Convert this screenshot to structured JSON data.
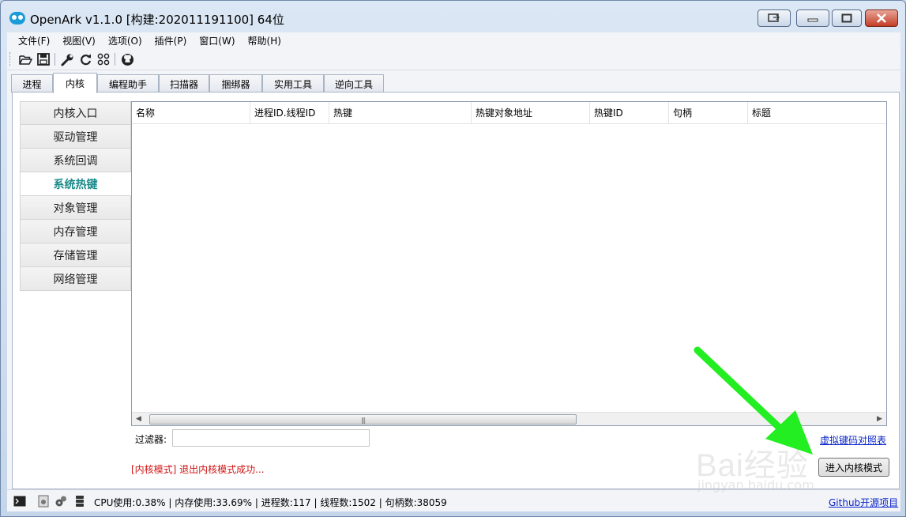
{
  "window": {
    "title": "OpenArk v1.1.0  [构建:202011191100]  64位"
  },
  "menu": [
    "文件(F)",
    "视图(V)",
    "选项(O)",
    "插件(P)",
    "窗口(W)",
    "帮助(H)"
  ],
  "toolbar": {
    "icons": [
      "open-folder-icon",
      "save-icon",
      "wrench-icon",
      "refresh-icon",
      "grid-icon",
      "github-icon"
    ]
  },
  "tabs": [
    "进程",
    "内核",
    "编程助手",
    "扫描器",
    "捆绑器",
    "实用工具",
    "逆向工具"
  ],
  "active_tab": "内核",
  "side_nav": [
    "内核入口",
    "驱动管理",
    "系统回调",
    "系统热键",
    "对象管理",
    "内存管理",
    "存储管理",
    "网络管理"
  ],
  "active_side": "系统热键",
  "table": {
    "columns": [
      "名称",
      "进程ID.线程ID",
      "热键",
      "热键对象地址",
      "热键ID",
      "句柄",
      "标题"
    ],
    "rows": []
  },
  "filter": {
    "label": "过滤器:",
    "value": ""
  },
  "vk_link": "虚拟键码对照表",
  "status_message": "[内核模式] 退出内核模式成功...",
  "mode_button": "进入内核模式",
  "statusbar": {
    "text": "CPU使用:0.38% | 内存使用:33.69% | 进程数:117 | 线程数:1502 | 句柄数:38059",
    "link": "Github开源项目"
  },
  "watermark": {
    "main": "Bai经验",
    "sub": "jingyan.baidu.com"
  },
  "colors": {
    "active_side_text": "#1a8a8a",
    "status_message": "#d01414",
    "link": "#0b24c8",
    "annotation_arrow": "#22ee22"
  }
}
